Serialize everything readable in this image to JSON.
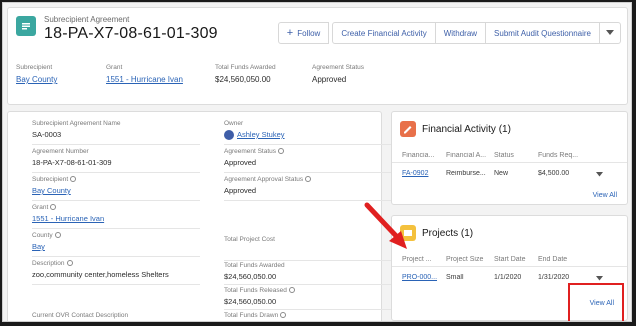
{
  "header": {
    "object_type": "Subrecipient Agreement",
    "title": "18-PA-X7-08-61-01-309",
    "actions": {
      "follow": "Follow",
      "create_financial_activity": "Create Financial Activity",
      "withdraw": "Withdraw",
      "submit_audit": "Submit Audit Questionnaire"
    },
    "highlights": [
      {
        "label": "Subrecipient",
        "value": "Bay County"
      },
      {
        "label": "Grant",
        "value": "1551 - Hurricane Ivan"
      },
      {
        "label": "Total Funds Awarded",
        "value": "$24,560,050.00"
      },
      {
        "label": "Agreement Status",
        "value": "Approved"
      }
    ]
  },
  "detail": {
    "left": [
      {
        "label": "Subrecipient Agreement Name",
        "value": "SA-0003"
      },
      {
        "label": "Agreement Number",
        "value": "18-PA-X7-08-61-01-309"
      },
      {
        "label": "Subrecipient",
        "value": "Bay County"
      },
      {
        "label": "Grant",
        "value": "1551 - Hurricane Ivan"
      },
      {
        "label": "County",
        "value": "Bay"
      },
      {
        "label": "Description",
        "value": "zoo,community center,homeless Shelters"
      },
      {
        "label": "Current OVR Contact Description",
        "value": ""
      }
    ],
    "right": [
      {
        "label": "Owner",
        "value": "Ashley Stukey"
      },
      {
        "label": "Agreement Status",
        "value": "Approved"
      },
      {
        "label": "Agreement Approval Status",
        "value": "Approved"
      },
      {
        "label": "Total Project Cost",
        "value": ""
      },
      {
        "label": "Total Funds Awarded",
        "value": "$24,560,050.00"
      },
      {
        "label": "Total Funds Released",
        "value": "$24,560,050.00"
      },
      {
        "label": "Total Funds Drawn",
        "value": ""
      }
    ]
  },
  "financial_activity": {
    "title": "Financial Activity (1)",
    "columns": [
      "Financia...",
      "Financial A...",
      "Status",
      "Funds Req..."
    ],
    "rows": [
      [
        "FA-0902",
        "Reimburse...",
        "New",
        "$4,500.00"
      ]
    ],
    "view_all": "View All"
  },
  "projects": {
    "title": "Projects (1)",
    "columns": [
      "Project ...",
      "Project Size",
      "Start Date",
      "End Date"
    ],
    "rows": [
      [
        "PRO-000...",
        "Small",
        "1/1/2020",
        "1/31/2020"
      ]
    ],
    "view_all": "View All"
  },
  "colors": {
    "object_icon": "#3ba7a0",
    "financial_icon": "#e8704a",
    "projects_icon": "#f4c13d",
    "link": "#2a63b6",
    "annotation": "#e02020"
  }
}
